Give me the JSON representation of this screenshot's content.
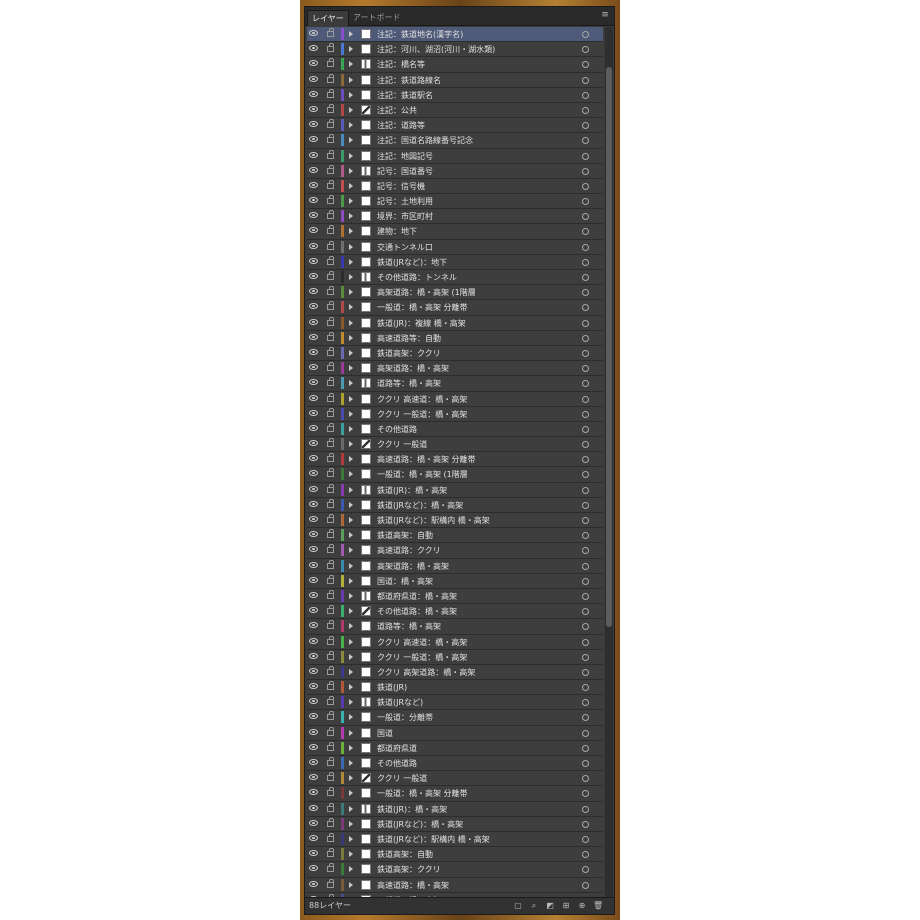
{
  "panel": {
    "tabs": [
      "レイヤー",
      "アートボード"
    ],
    "menu_icon": "panel-menu-icon",
    "footer_label": "88レイヤー",
    "footer_icons": [
      "export-icon",
      "locate-icon",
      "make-clip-mask-icon",
      "new-sublayer-icon",
      "new-layer-icon",
      "trash-icon"
    ]
  },
  "colors": {
    "panel_bg": "#3b3b3b",
    "row_bg": "#3e3e3e",
    "selected_row": "#4f5a78",
    "text": "#e2e2e2",
    "backdrop": "#b57a2c"
  },
  "layers": [
    {
      "name": "注記：鉄道地名(漢字名)",
      "color": "#8a4fd1",
      "selected": true
    },
    {
      "name": "注記：河川、湖沼(河川・湖水類)",
      "color": "#4a78d4"
    },
    {
      "name": "注記：橋名等",
      "color": "#3aa655"
    },
    {
      "name": "注記：鉄道路線名",
      "color": "#8d6a3a"
    },
    {
      "name": "注記：鉄道駅名",
      "color": "#6d4dbf"
    },
    {
      "name": "注記：公共",
      "color": "#b04848"
    },
    {
      "name": "注記：道路等",
      "color": "#5a5ab8"
    },
    {
      "name": "注記：国道名路線番号記念",
      "color": "#4a8ac0"
    },
    {
      "name": "注記：地図記号",
      "color": "#3c9a6a"
    },
    {
      "name": "記号：国道番号",
      "color": "#b05a8a"
    },
    {
      "name": "記号：信号機",
      "color": "#c05050"
    },
    {
      "name": "記号：土地利用",
      "color": "#4a9a4a"
    },
    {
      "name": "境界：市区町村",
      "color": "#8a4ac0"
    },
    {
      "name": "建物：地下",
      "color": "#b07030"
    },
    {
      "name": "交通トンネル口",
      "color": "#707070"
    },
    {
      "name": "鉄道(JRなど)：地下",
      "color": "#3a3ab0"
    },
    {
      "name": "その他道路：トンネル",
      "color": "#2a2a2a"
    },
    {
      "name": "高架道路：橋・高架 (1階層",
      "color": "#5a8a3a"
    },
    {
      "name": "一般道：橋・高架 分離帯",
      "color": "#b04a4a"
    },
    {
      "name": "鉄道(JR)：複線 橋・高架",
      "color": "#8a5a2a"
    },
    {
      "name": "高速道路等：自動",
      "color": "#c08a30"
    },
    {
      "name": "鉄道高架：ククリ",
      "color": "#6a6ab0"
    },
    {
      "name": "高架道路：橋・高架",
      "color": "#9a3a9a"
    },
    {
      "name": "道路等：橋・高架",
      "color": "#4a9ab0"
    },
    {
      "name": "ククリ 高速道：橋・高架",
      "color": "#b0a030"
    },
    {
      "name": "ククリ 一般道：橋・高架",
      "color": "#4a4ab0"
    },
    {
      "name": "その他道路",
      "color": "#3aa0a0"
    },
    {
      "name": "ククリ 一般道",
      "color": "#6a6a6a"
    },
    {
      "name": "高速道路：橋・高架 分離帯",
      "color": "#b03a3a"
    },
    {
      "name": "一般道：橋・高架 (1階層",
      "color": "#3a7a3a"
    },
    {
      "name": "鉄道(JR)：橋・高架",
      "color": "#8a3ab0"
    },
    {
      "name": "鉄道(JRなど)：橋・高架",
      "color": "#3a5ab0"
    },
    {
      "name": "鉄道(JRなど)：駅構内 橋・高架",
      "color": "#b06a3a"
    },
    {
      "name": "鉄道高架：自動",
      "color": "#5aa05a"
    },
    {
      "name": "高速道路：ククリ",
      "color": "#a05ab0"
    },
    {
      "name": "高架道路：橋・高架",
      "color": "#3a8ab0"
    },
    {
      "name": "国道：橋・高架",
      "color": "#b0b03a"
    },
    {
      "name": "都道府県道：橋・高架",
      "color": "#6a3ab0"
    },
    {
      "name": "その他道路：橋・高架",
      "color": "#3ab06a"
    },
    {
      "name": "道路等：橋・高架",
      "color": "#b03a6a"
    },
    {
      "name": "ククリ 高速道：橋・高架",
      "color": "#4ab04a"
    },
    {
      "name": "ククリ 一般道：橋・高架",
      "color": "#8a8a3a"
    },
    {
      "name": "ククリ 高架道路：橋・高架",
      "color": "#3a3a8a"
    },
    {
      "name": "鉄道(JR)",
      "color": "#b05a3a"
    },
    {
      "name": "鉄道(JRなど)",
      "color": "#5a3ab0"
    },
    {
      "name": "一般道：分離帯",
      "color": "#3ab0b0"
    },
    {
      "name": "国道",
      "color": "#b03ab0"
    },
    {
      "name": "都道府県道",
      "color": "#6ab03a"
    },
    {
      "name": "その他道路",
      "color": "#3a6ab0"
    },
    {
      "name": "ククリ 一般道",
      "color": "#b08a3a"
    },
    {
      "name": "一般道：橋・高架 分離帯",
      "color": "#7a3a3a"
    },
    {
      "name": "鉄道(JR)：橋・高架",
      "color": "#3a7a7a"
    },
    {
      "name": "鉄道(JRなど)：橋・高架",
      "color": "#7a3a7a"
    },
    {
      "name": "鉄道(JRなど)：駅構内 橋・高架",
      "color": "#3a3a7a"
    },
    {
      "name": "鉄道高架：自動",
      "color": "#7a7a3a"
    },
    {
      "name": "鉄道高架：ククリ",
      "color": "#3a7a3a"
    },
    {
      "name": "高速道路：橋・高架",
      "color": "#7a5a3a"
    },
    {
      "name": "一般道：橋・高架",
      "color": "#4a4a9a"
    }
  ]
}
